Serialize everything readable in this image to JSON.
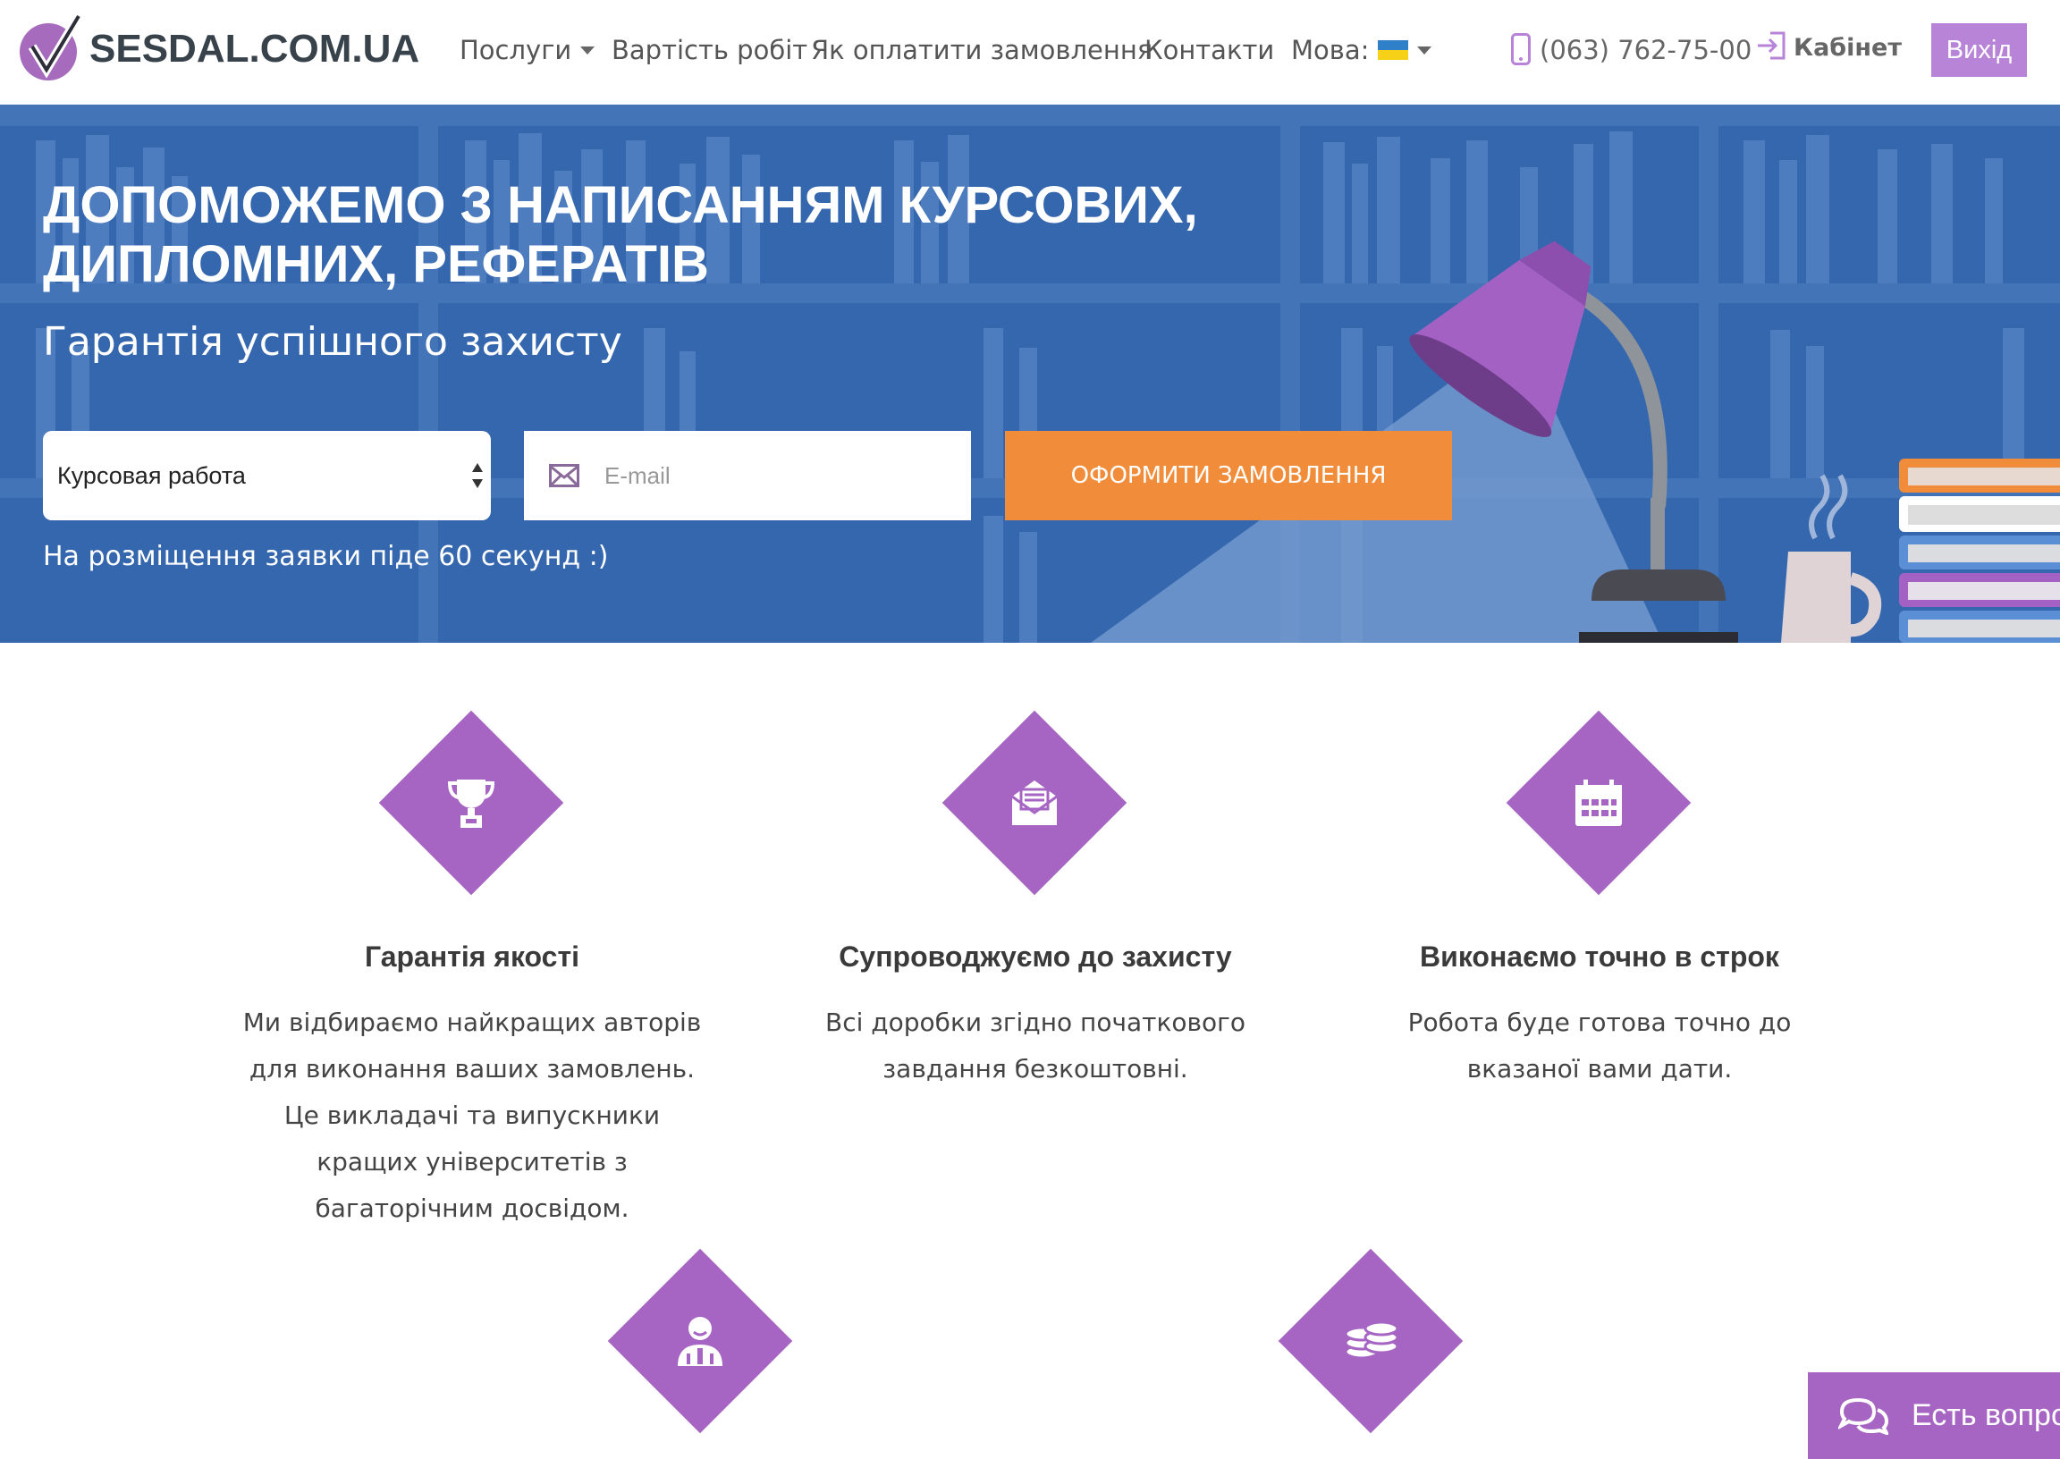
{
  "header": {
    "logo_text": "SESDAL.COM.UA",
    "nav": {
      "services": "Послуги",
      "pricing": "Вартість робіт",
      "how_to_pay": "Як оплатити замовлення",
      "contacts": "Контакти",
      "language": "Мова:"
    },
    "phone": "(063) 762-75-00",
    "cabinet": "Кабінет",
    "logout": "Вихід"
  },
  "hero": {
    "title_line1": "Допоможемо з написанням курсових,",
    "title_line2": "дипломних, рефератів",
    "subtitle": "Гарантія успішного захисту",
    "work_type_selected": "Курсовая работа",
    "email_placeholder": "E-mail",
    "submit_label": "ОФОРМИТИ ЗАМОВЛЕННЯ",
    "note": "На розміщення заявки піде 60 секунд :)"
  },
  "features": [
    {
      "icon": "trophy-icon",
      "title": "Гарантія якості",
      "lines": [
        "Ми відбираємо найкращих авторів",
        "для виконання ваших замовлень.",
        "Це викладачі та випускники",
        "кращих університетів з",
        "багаторічним досвідом."
      ]
    },
    {
      "icon": "envelope-open-icon",
      "title": "Супроводжуємо до захисту",
      "lines": [
        "Всі доробки згідно початкового",
        "завдання безкоштовні."
      ]
    },
    {
      "icon": "calendar-icon",
      "title": "Виконаємо точно в строк",
      "lines": [
        "Робота буде готова точно до",
        "вказаної вами дати."
      ]
    },
    {
      "icon": "support-agent-icon"
    },
    {
      "icon": "coins-icon"
    }
  ],
  "chat": {
    "label": "Есть вопросы?"
  },
  "colors": {
    "brand_purple": "#a665c2",
    "hero_blue": "#3567ae",
    "cta_orange": "#f08c3a",
    "logout_purple": "#b784d8"
  }
}
